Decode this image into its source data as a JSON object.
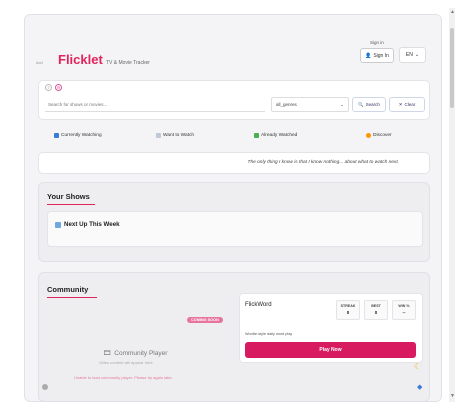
{
  "header": {
    "brand_small": "ddd",
    "brand": "Flicklet",
    "tagline": "TV & Movie Tracker",
    "signin_label": "Sign in",
    "signin_button": "Sign In",
    "language": "EN"
  },
  "search": {
    "placeholder": "Search for shows or movies...",
    "genre_selected": "all_genres",
    "search_label": "Search",
    "clear_label": "Clear"
  },
  "tabs": [
    {
      "label": "Currently Watching",
      "icon": "tv-icon",
      "color": "#3a7bd5"
    },
    {
      "label": "Want to Watch",
      "icon": "bookmark-icon",
      "color": "#9ab"
    },
    {
      "label": "Already Watched",
      "icon": "check-icon",
      "color": "#4caf50"
    },
    {
      "label": "Discover",
      "icon": "sparkle-icon",
      "color": "#ff9800"
    }
  ],
  "quote": "The only thing I know is that I know nothing... about what to watch next.",
  "your_shows": {
    "title": "Your Shows",
    "up_next": "Next Up This Week"
  },
  "community": {
    "title": "Community",
    "badge": "COMING SOON",
    "player_title": "Community Player",
    "player_sub": "Video content will appear here",
    "player_error": "Unable to load community player. Please try again later."
  },
  "flickword": {
    "title": "FlickWord",
    "stats": [
      {
        "label": "STREAK",
        "value": "0"
      },
      {
        "label": "BEST",
        "value": "0"
      },
      {
        "label": "WIN %",
        "value": "--"
      }
    ],
    "description": "Wordle-style daily word play",
    "play_label": "Play Now"
  },
  "colors": {
    "brand": "#e0245e",
    "play": "#d81b60"
  }
}
